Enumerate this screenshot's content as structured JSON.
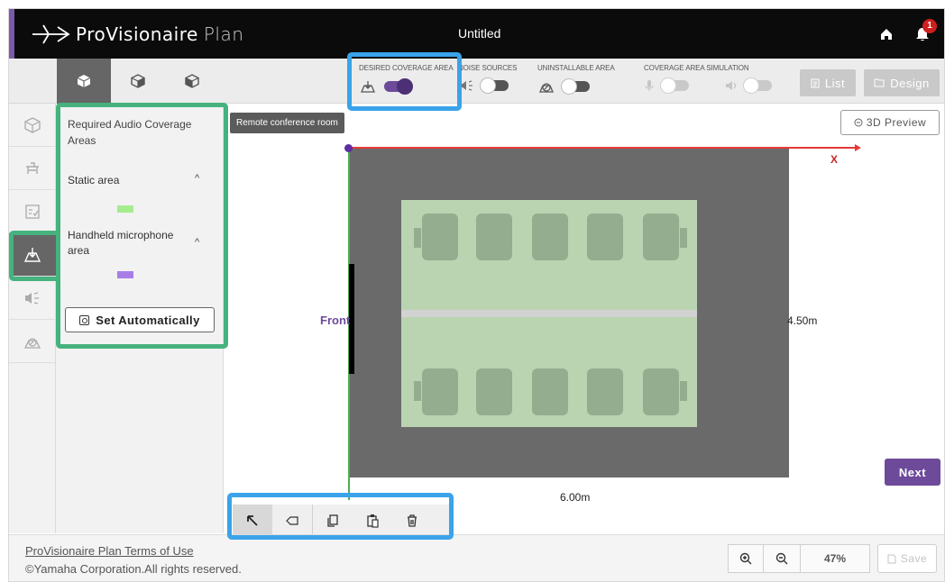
{
  "app": {
    "name": "ProVisionaire",
    "name_suffix": "Plan",
    "document_title": "Untitled",
    "notification_count": "1"
  },
  "toolbar": {
    "view_tabs": [
      {
        "icon": "cube-top-icon",
        "active": true
      },
      {
        "icon": "cube-side-icon",
        "active": false
      },
      {
        "icon": "cube-front-icon",
        "active": false
      }
    ],
    "toggles": {
      "desired_coverage": {
        "label": "DESIRED COVERAGE AREA",
        "on": true
      },
      "noise_sources": {
        "label": "NOISE SOURCES",
        "on": false
      },
      "uninstallable": {
        "label": "UNINSTALLABLE AREA",
        "on": false
      },
      "simulation": {
        "label": "COVERAGE AREA SIMULATION"
      }
    },
    "list_label": "List",
    "design_label": "Design"
  },
  "sidebar": {
    "title": "Required Audio Coverage Areas",
    "static_area_label": "Static area",
    "handheld_label": "Handheld microphone area",
    "set_auto_label": "Set Automatically",
    "static_color": "#a6ec8f",
    "handheld_color": "#a77ee6"
  },
  "canvas": {
    "room_name": "Remote conference room",
    "preview_label": "3D Preview",
    "axis_x_label": "X",
    "front_label": "Front",
    "height_dim": "4.50m",
    "width_dim": "6.00m",
    "next_label": "Next"
  },
  "footer": {
    "terms_label": "ProVisionaire Plan Terms of Use",
    "copyright": "©Yamaha Corporation.All rights reserved.",
    "zoom_level": "47%",
    "save_label": "Save"
  },
  "colors": {
    "accent": "#6d4a9a",
    "highlight_blue": "#3aa3ea",
    "highlight_green": "#46b27e",
    "header_bg": "#0b0b0b"
  }
}
